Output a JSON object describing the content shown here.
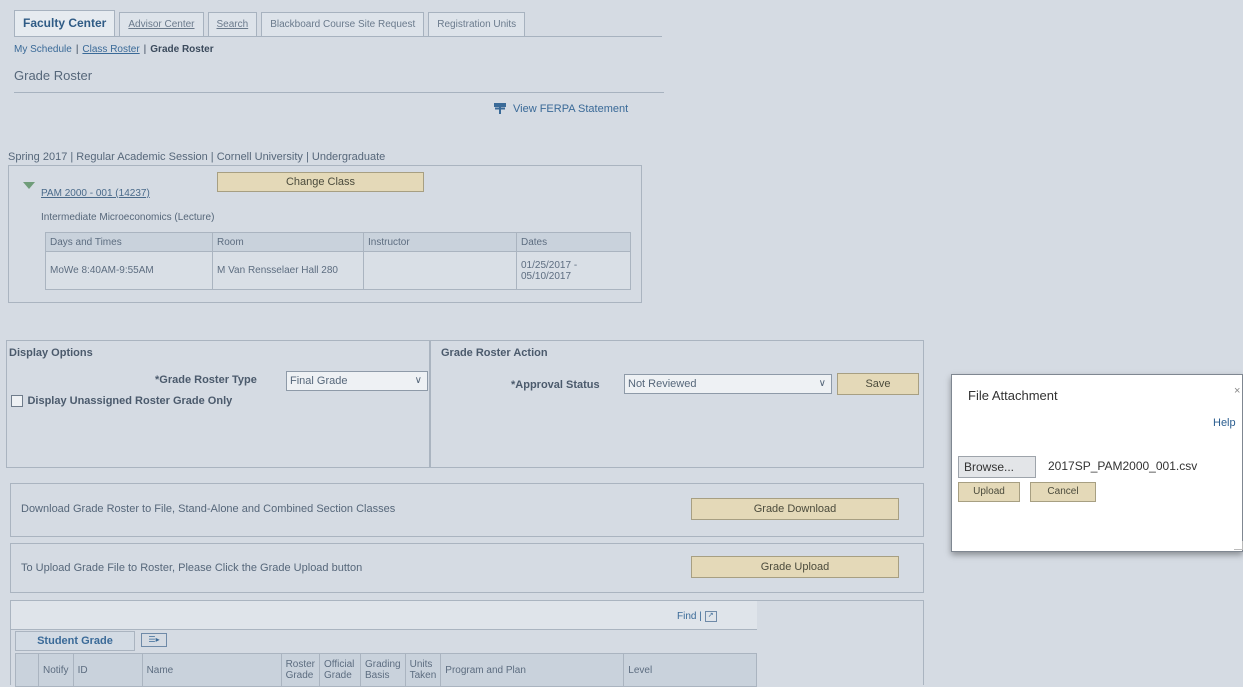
{
  "tabs": [
    {
      "label": "Faculty Center",
      "active": true
    },
    {
      "label": "Advisor Center",
      "active": false
    },
    {
      "label": "Search",
      "active": false
    },
    {
      "label": "Blackboard Course Site Request",
      "active": false
    },
    {
      "label": "Registration Units",
      "active": false
    }
  ],
  "subnav": {
    "my_schedule": "My Schedule",
    "sep": "|",
    "class_roster": "Class Roster",
    "grade_roster": "Grade Roster"
  },
  "page_title": "Grade Roster",
  "ferpa_link": "View FERPA Statement",
  "term": "Spring 2017 | Regular Academic Session | Cornell University | Undergraduate",
  "class_info": {
    "class_link": "PAM 2000 - 001 (14237)",
    "change_class": "Change Class",
    "description": "Intermediate Microeconomics (Lecture)",
    "columns": [
      "Days and Times",
      "Room",
      "Instructor",
      "Dates"
    ],
    "row": {
      "days": "MoWe 8:40AM-9:55AM",
      "room": "M Van Rensselaer Hall 280",
      "instructor": "",
      "dates": "01/25/2017 - 05/10/2017"
    }
  },
  "display_options": {
    "heading": "Display Options",
    "roster_type_label": "*Grade Roster Type",
    "roster_type_value": "Final Grade",
    "unassigned_label": "Display Unassigned Roster Grade Only"
  },
  "roster_action": {
    "heading": "Grade Roster Action",
    "approval_label": "*Approval Status",
    "approval_value": "Not Reviewed",
    "save": "Save"
  },
  "download": {
    "text": "Download Grade Roster to File, Stand-Alone and Combined Section Classes",
    "button": "Grade Download"
  },
  "upload": {
    "text": "To Upload Grade File to Roster, Please Click the Grade Upload button",
    "button": "Grade Upload"
  },
  "student_grade": {
    "find": "Find |",
    "tab": "Student Grade",
    "columns": [
      "Notify",
      "ID",
      "Name",
      "Roster Grade",
      "Official Grade",
      "Grading Basis",
      "Units Taken",
      "Program and Plan",
      "Level"
    ]
  },
  "dialog": {
    "title": "File Attachment",
    "close": "×",
    "help": "Help",
    "browse": "Browse...",
    "filename": "2017SP_PAM2000_001.csv",
    "upload": "Upload",
    "cancel": "Cancel"
  },
  "colors": {
    "background": "#d5dbe3",
    "button": "#e4d9b8",
    "link": "#3a6a98"
  }
}
